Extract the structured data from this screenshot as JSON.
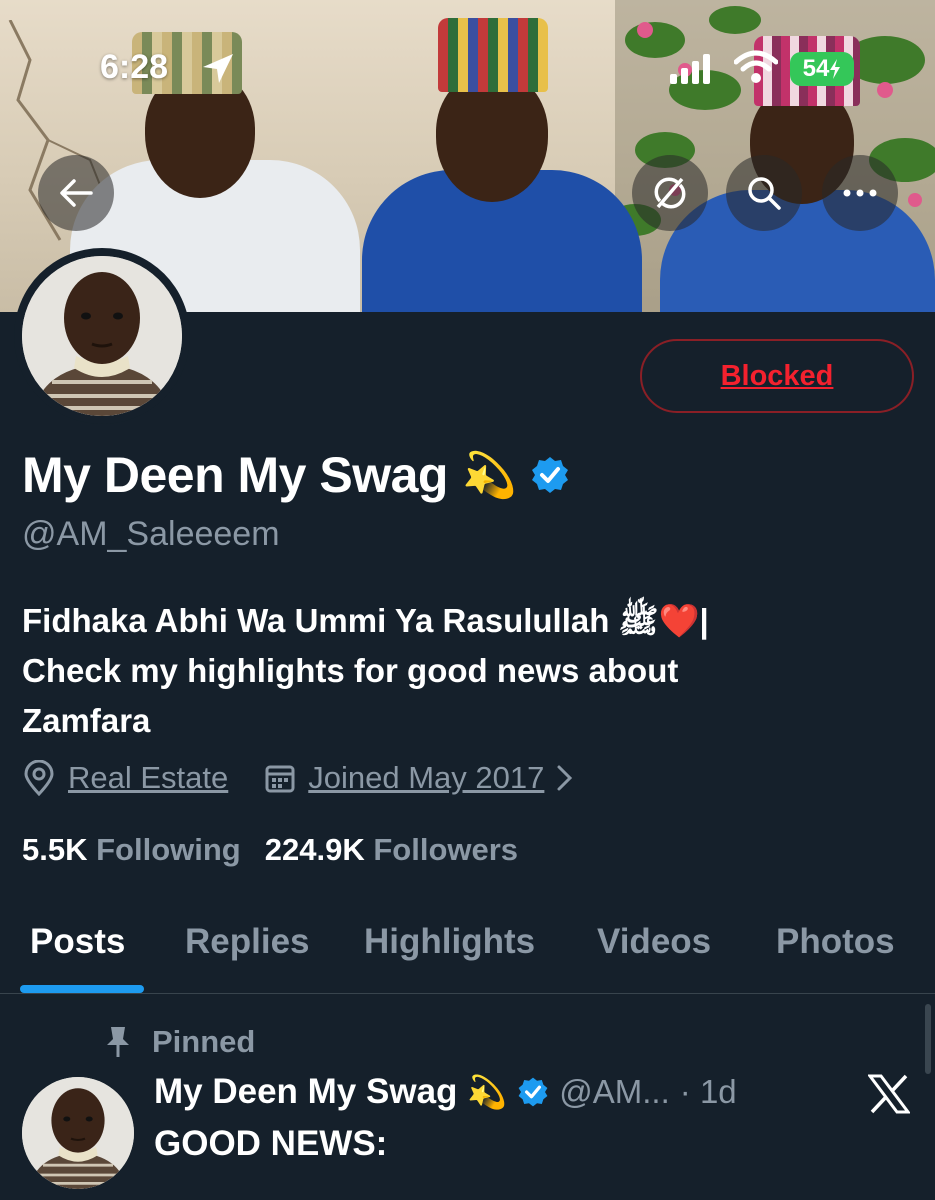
{
  "status_bar": {
    "time": "6:28",
    "battery": "54"
  },
  "banner": {
    "back_icon": "arrow-left-icon",
    "action_icons": [
      "share-refresh-icon",
      "search-icon",
      "more-icon"
    ]
  },
  "profile": {
    "action_button": "Blocked",
    "display_name": "My Deen My Swag",
    "name_emoji": "💫",
    "handle": "@AM_Saleeeem",
    "bio_line1": "Fidhaka Abhi Wa Ummi Ya Rasulullah ﷺ❤️|",
    "bio_line2": "Check my highlights for good news about",
    "bio_line3": "Zamfara",
    "category": "Real Estate",
    "joined": "Joined May 2017",
    "following_count": "5.5K",
    "following_label": "Following",
    "followers_count": "224.9K",
    "followers_label": "Followers"
  },
  "tabs": [
    {
      "label": "Posts",
      "active": true
    },
    {
      "label": "Replies",
      "active": false
    },
    {
      "label": "Highlights",
      "active": false
    },
    {
      "label": "Videos",
      "active": false
    },
    {
      "label": "Photos",
      "active": false
    }
  ],
  "pinned_tweet": {
    "pinned_label": "Pinned",
    "author_name": "My Deen My Swag",
    "author_emoji": "💫",
    "author_handle": "@AM...",
    "age": "· 1d",
    "text": "GOOD NEWS:"
  },
  "colors": {
    "background": "#15202b",
    "accent": "#1d9bf0",
    "blocked_red": "#f4212e",
    "muted_text": "#8b98a5"
  }
}
